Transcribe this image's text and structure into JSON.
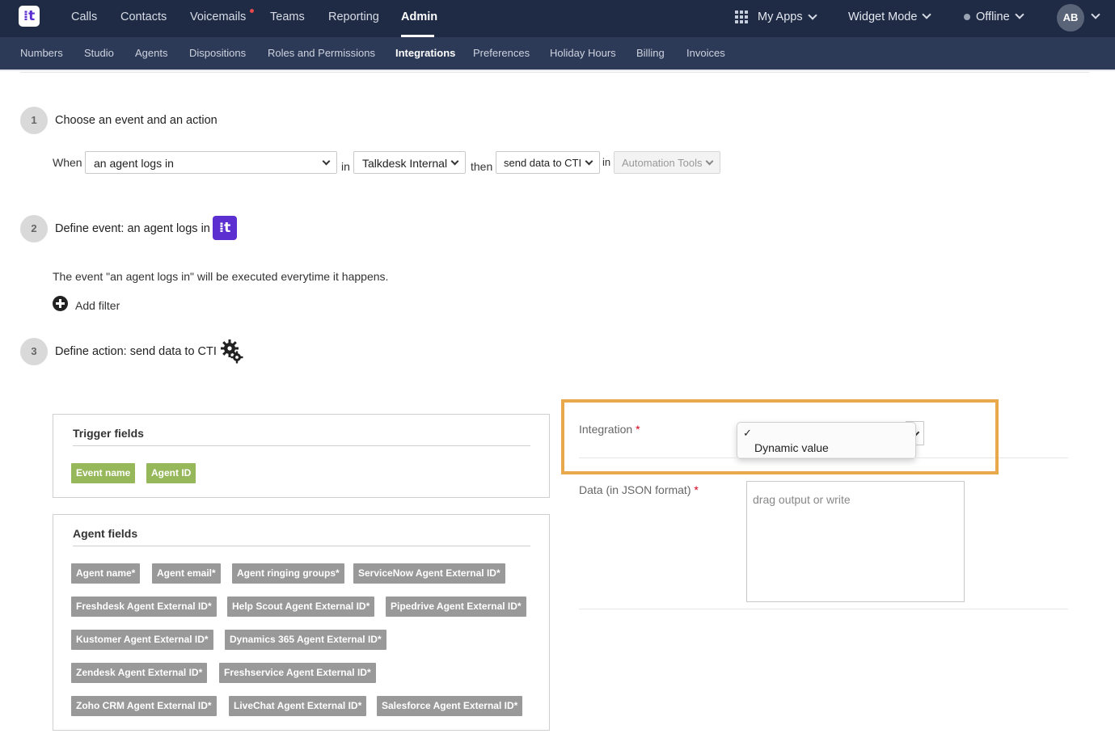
{
  "topbar": {
    "logo_glyph": "⁞t",
    "nav": [
      "Calls",
      "Contacts",
      "Voicemails",
      "Teams",
      "Reporting",
      "Admin"
    ],
    "active_nav": "Admin",
    "my_apps": "My Apps",
    "widget_mode": "Widget Mode",
    "status": "Offline",
    "avatar_initials": "AB"
  },
  "subnav": {
    "items": [
      "Numbers",
      "Studio",
      "Agents",
      "Dispositions",
      "Roles and Permissions",
      "Integrations",
      "Preferences",
      "Holiday Hours",
      "Billing",
      "Invoices"
    ],
    "active": "Integrations"
  },
  "step1": {
    "number": "1",
    "title": "Choose an event and an action",
    "when_label": "When",
    "event_value": "an agent logs in",
    "in_label": "in",
    "source_value": "Talkdesk Internal",
    "then_label": "then",
    "action_value": "send data to CTI",
    "in_label2": "in",
    "target_value": "Automation Tools"
  },
  "step2": {
    "number": "2",
    "title": "Define event: an agent logs in",
    "badge_glyph": "⁞t",
    "description": "The event \"an agent logs in\" will be executed everytime it happens.",
    "add_filter": "Add filter"
  },
  "step3": {
    "number": "3",
    "title": "Define action: send data to CTI"
  },
  "trigger_fields": {
    "title": "Trigger fields",
    "chips": [
      "Event name",
      "Agent ID"
    ]
  },
  "agent_fields": {
    "title": "Agent fields",
    "chips": [
      "Agent name*",
      "Agent email*",
      "Agent ringing groups*",
      "ServiceNow Agent External ID*",
      "Freshdesk Agent External ID*",
      "Help Scout Agent External ID*",
      "Pipedrive Agent External ID*",
      "Kustomer Agent External ID*",
      "Dynamics 365 Agent External ID*",
      "Zendesk Agent External ID*",
      "Freshservice Agent External ID*",
      "Zoho CRM Agent External ID*",
      "LiveChat Agent External ID*",
      "Salesforce Agent External ID*"
    ]
  },
  "form": {
    "integration_label": "Integration",
    "required_mark": "*",
    "dropdown_check": "✓",
    "dropdown_option": "Dynamic value",
    "data_label": "Data (in JSON format)",
    "data_placeholder": "drag output or write"
  },
  "colors": {
    "topbar": "#1f2a44",
    "subnav": "#2d3a57",
    "brand_purple": "#5b2fd0",
    "chip_green": "#97b85a",
    "chip_gray": "#999999",
    "highlight": "#e8a94a",
    "required": "#d0021b"
  }
}
